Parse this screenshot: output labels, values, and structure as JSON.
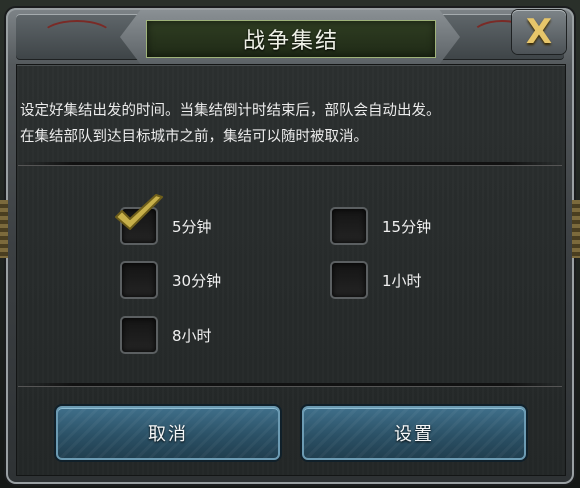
{
  "dialog": {
    "title": "战争集结",
    "close_label": "X",
    "description_lines": [
      "设定好集结出发的时间。当集结倒计时结束后，部队会自动出发。",
      "在集结部队到达目标城市之前，集结可以随时被取消。"
    ]
  },
  "options": [
    {
      "label": "5分钟",
      "checked": true
    },
    {
      "label": "15分钟",
      "checked": false
    },
    {
      "label": "30分钟",
      "checked": false
    },
    {
      "label": "1小时",
      "checked": false
    },
    {
      "label": "8小时",
      "checked": false
    }
  ],
  "buttons": {
    "cancel_label": "取消",
    "confirm_label": "设置"
  },
  "colors": {
    "title_bg": "#2f3d22",
    "button_blue": "#2b5166",
    "check_gold": "#c7b04a",
    "close_gold": "#e7c66a"
  }
}
